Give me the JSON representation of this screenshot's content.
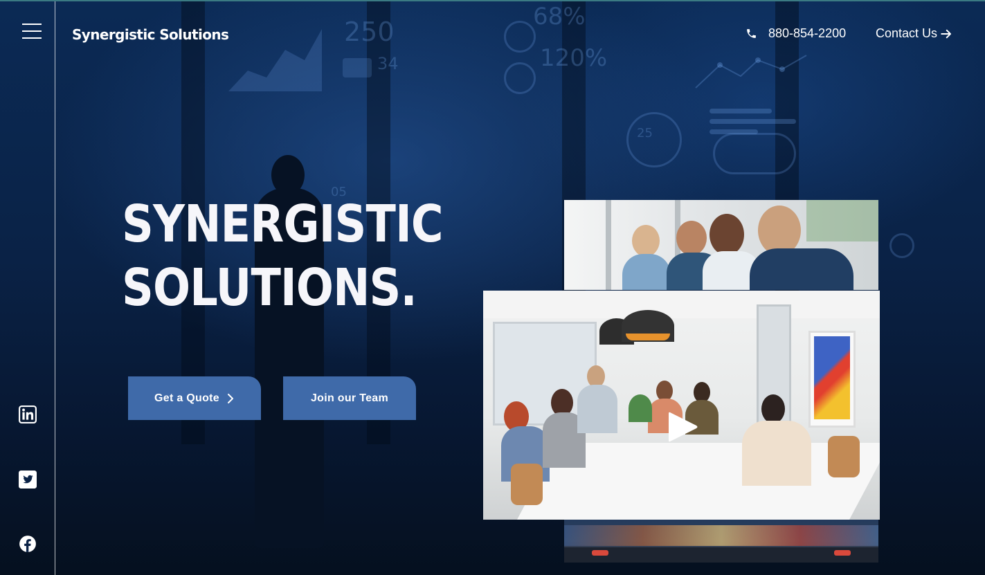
{
  "brand": {
    "name": "Synergistic Solutions"
  },
  "header": {
    "phone": "880-854-2200",
    "contact_label": "Contact Us"
  },
  "hero": {
    "headline_line1": "SYNERGISTIC",
    "headline_line2": "SOLUTIONS."
  },
  "buttons": {
    "quote_label": "Get a Quote",
    "team_label": "Join our Team"
  },
  "background_deco": {
    "n1": "250",
    "n2": "34",
    "n3": "68%",
    "n4": "120%",
    "n5": "25",
    "n6": "05"
  },
  "social": [
    "linkedin-icon",
    "twitter-icon",
    "facebook-icon"
  ],
  "icons": {
    "menu": "hamburger-menu-icon",
    "phone": "phone-icon",
    "contact_arrow": "arrow-right-icon",
    "quote_chevron": "chevron-right-icon",
    "video_play": "play-icon"
  },
  "colors": {
    "accent_button": "#3f6aa9",
    "background": "#0a2246",
    "text": "#ffffff",
    "top_line": "#3b7b83"
  }
}
